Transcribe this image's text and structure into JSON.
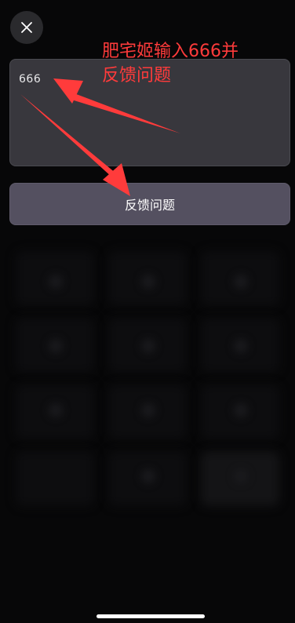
{
  "dialog": {
    "input_value": "666",
    "submit_label": "反馈问题"
  },
  "annotation": {
    "line1": "肥宅姬输入666并",
    "line2": "反馈问题",
    "color": "#ff3b3b"
  },
  "icons": {
    "close": "close-icon"
  }
}
